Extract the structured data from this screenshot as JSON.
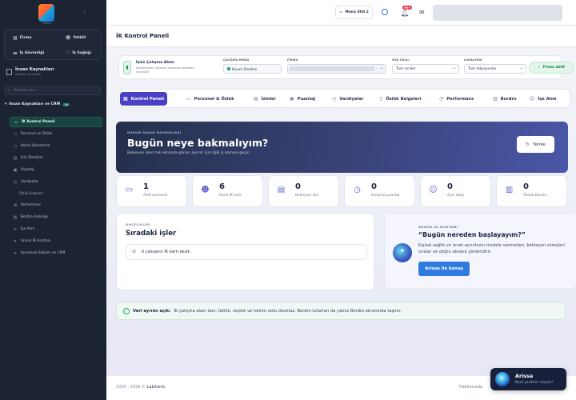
{
  "brand": {
    "logo_sub": "ByTech"
  },
  "sidebar": {
    "quick": [
      {
        "label": "Firma",
        "icon": "building-icon"
      },
      {
        "label": "Yetkili",
        "icon": "user-group-icon"
      },
      {
        "label": "İş Güvenliği",
        "icon": "car-icon"
      },
      {
        "label": "İş Sağlığı",
        "icon": "stethoscope-icon"
      }
    ],
    "org_title": "İnsan Kaynakları",
    "org_sub": "işletme hat ortam",
    "search_placeholder": "Menüde ara...",
    "section_title": "İnsan Kaynakları ve CRM",
    "section_badge": "16",
    "items": [
      {
        "label": "İK Kontrol Paneli",
        "icon": "dashboard-icon",
        "active": true
      },
      {
        "label": "Personel ve Özlük",
        "icon": "id-card-icon"
      },
      {
        "label": "Kendi İşlemlerim",
        "icon": "person-icon"
      },
      {
        "label": "İzin Yönetimi",
        "icon": "calendar-icon"
      },
      {
        "label": "Puantaj",
        "icon": "clipboard-icon"
      },
      {
        "label": "Vardiyalar",
        "icon": "clock-icon"
      },
      {
        "label": "Özlük Belgeleri",
        "icon": "",
        "sub": true
      },
      {
        "label": "Performans",
        "icon": "chart-icon"
      },
      {
        "label": "Bordro Hazırlığı",
        "icon": "receipt-icon"
      },
      {
        "label": "İşe Alım",
        "icon": "user-plus-icon"
      },
      {
        "label": "Arissa İK Asistanı",
        "icon": "sparkle-icon"
      },
      {
        "label": "Kurumsal İlişkiler ve CRM",
        "icon": "handshake-icon"
      }
    ]
  },
  "topbar": {
    "menu_chip": "Menü Stili 2",
    "notif_badge": "99+"
  },
  "page": {
    "title": "İK Kontrol Paneli"
  },
  "filter": {
    "title": "İşsiz Çalışma Alanı",
    "desc": "Kullanıcıdaki yönetim verilerine işlemleri yürütülür",
    "mode_label": "ÇALIŞMA MODU",
    "mode_value": "Kurum Yönetimi",
    "firm_label": "FİRMA",
    "sgk_label": "SGK SİCİLİ",
    "sgk_value": "Tüm siciller",
    "loc_label": "LOKASYON",
    "loc_value": "Tüm lokasyonlar",
    "active_pill": "Firma aktif"
  },
  "tabs": [
    {
      "label": "Kontrol Paneli",
      "icon": "grid-icon",
      "active": true
    },
    {
      "label": "Personel & Özlük",
      "icon": "id-card-icon"
    },
    {
      "label": "İzinler",
      "icon": "calendar-icon"
    },
    {
      "label": "Puantaj",
      "icon": "clipboard-icon"
    },
    {
      "label": "Vardiyalar",
      "icon": "clock-icon"
    },
    {
      "label": "Özlük Belgeleri",
      "icon": "file-icon"
    },
    {
      "label": "Performans",
      "icon": "chart-icon"
    },
    {
      "label": "Bordro",
      "icon": "receipt-icon"
    },
    {
      "label": "İşe Alım",
      "icon": "user-plus-icon"
    }
  ],
  "hero": {
    "kicker": "KURUM İNSAN KAYNAKLARI",
    "title": "Bugün neye bakmalıyım?",
    "subtitle": "Bekleyen işleri tek ekranda görün; ayrıntı için ilgili iş alanına geçin.",
    "refresh_label": "Yenile"
  },
  "stats": [
    {
      "value": "1",
      "label": "Aktif personel",
      "icon": "id-card-icon"
    },
    {
      "value": "6",
      "label": "Eksik İK kartı",
      "icon": "user-warning-icon"
    },
    {
      "value": "0",
      "label": "Bekleyen izin",
      "icon": "calendar-check-icon"
    },
    {
      "value": "0",
      "label": "Onaysız puantaj",
      "icon": "clock-icon"
    },
    {
      "value": "0",
      "label": "Açık aday",
      "icon": "user-plus-icon"
    },
    {
      "value": "0",
      "label": "Taslak bordro",
      "icon": "receipt-icon"
    }
  ],
  "priorities": {
    "kicker": "ÖNCELİKLER",
    "title": "Sıradaki işler",
    "items": [
      "6 çalışanın İK kartı eksik."
    ]
  },
  "assistant": {
    "kicker": "ARISSA İK ASİSTANI",
    "title": "“Bugün nereden başlayayım?”",
    "desc": "Kişisel sağlık ve ücret ayrıntısını modele vermeden, bekleyen süreçleri sıralar ve doğru ekrana yönlendirir.",
    "button": "Arissa ile konuş"
  },
  "note": {
    "bold": "Veri ayrımı açık:",
    "text": "İK çalışma alanı tanı, tetkik, reçete ve hekim notu okumaz. Bordro tutarları da yalnız Bordro ekranında taşınır."
  },
  "footer": {
    "left": "2020 - 2026 ©",
    "brand": "LabXonic",
    "right": "Hakkımızda"
  },
  "bot": {
    "name": "Arissa",
    "prompt": "Nasıl yardımcı olayım?"
  }
}
